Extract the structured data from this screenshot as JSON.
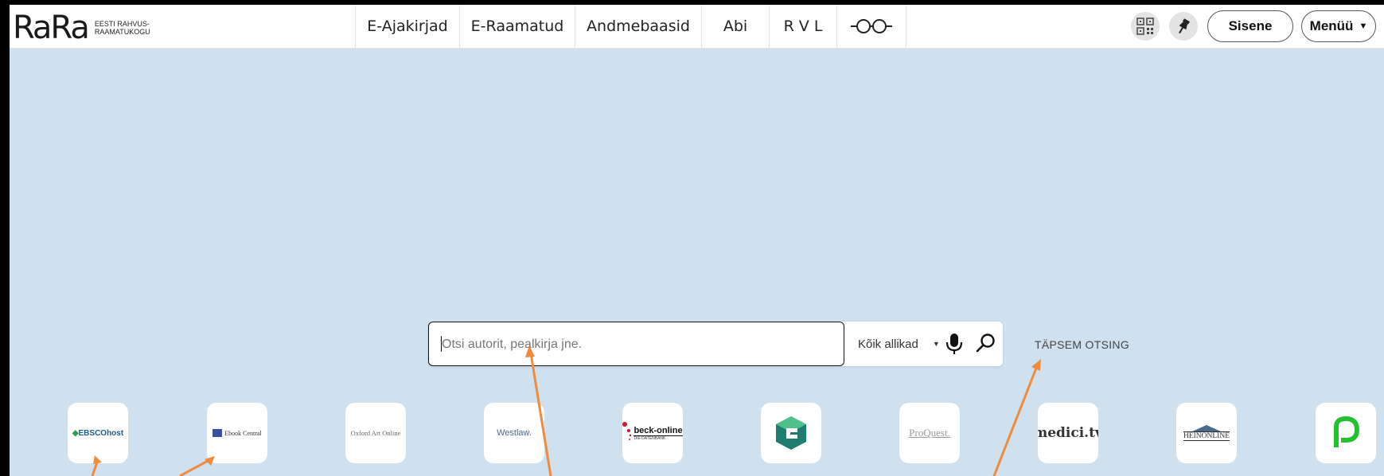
{
  "header": {
    "logo_mark": "RaRa",
    "logo_line1": "EESTI RAHVUS-",
    "logo_line2": "RAAMATUKOGU",
    "nav": [
      {
        "label": "E-Ajakirjad"
      },
      {
        "label": "E-Raamatud"
      },
      {
        "label": "Andmebaasid"
      },
      {
        "label": "Abi"
      },
      {
        "label": "R V L"
      },
      {
        "label": "-O-O-",
        "icon": "glasses-icon"
      }
    ],
    "sisene_label": "Sisene",
    "menu_label": "Menüü"
  },
  "search": {
    "placeholder": "Otsi autorit, pealkirja jne.",
    "source_label": "Kõik allikad",
    "advanced_label": "TÄPSEM OTSING"
  },
  "databases": [
    {
      "name": "EBSCOhost"
    },
    {
      "name": "Ebook Central"
    },
    {
      "name": "Oxford Art Online"
    },
    {
      "name": "Westlaw."
    },
    {
      "name": "beck-online",
      "sub": "DIE DATENBANK"
    },
    {
      "name": "e-logo"
    },
    {
      "name": "ProQuest."
    },
    {
      "name": "medici.tv"
    },
    {
      "name": "HEINONLINE"
    },
    {
      "name": "P-logo"
    }
  ],
  "colors": {
    "background": "#cfe0ef",
    "arrow": "#f08a3c",
    "medici": "#333333",
    "p_green": "#22c12e",
    "e_teal": "#1f7d70"
  }
}
